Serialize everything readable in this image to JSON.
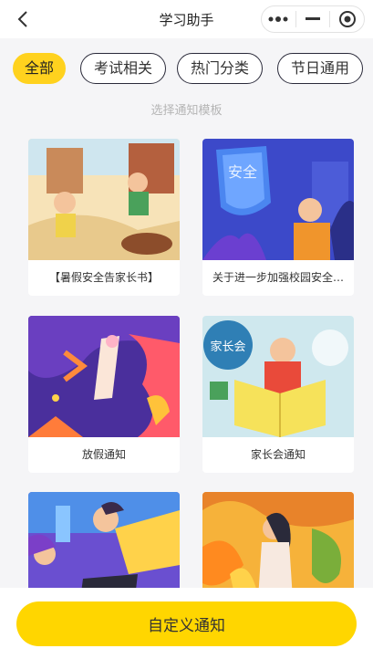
{
  "header": {
    "title": "学习助手"
  },
  "filters": [
    {
      "label": "全部",
      "active": true
    },
    {
      "label": "考试相关",
      "active": false
    },
    {
      "label": "热门分类",
      "active": false
    },
    {
      "label": "节日通用",
      "active": false
    }
  ],
  "subtitle": "选择通知模板",
  "templates": [
    {
      "title": "【暑假安全告家长书】"
    },
    {
      "title": "关于进一步加强校园安全…",
      "badge": "安全"
    },
    {
      "title": "放假通知"
    },
    {
      "title": "家长会通知",
      "badge": "家长会"
    },
    {
      "title": ""
    },
    {
      "title": ""
    }
  ],
  "footer": {
    "button_label": "自定义通知"
  },
  "colors": {
    "accent": "#ffd600",
    "background": "#f5f5f7"
  }
}
